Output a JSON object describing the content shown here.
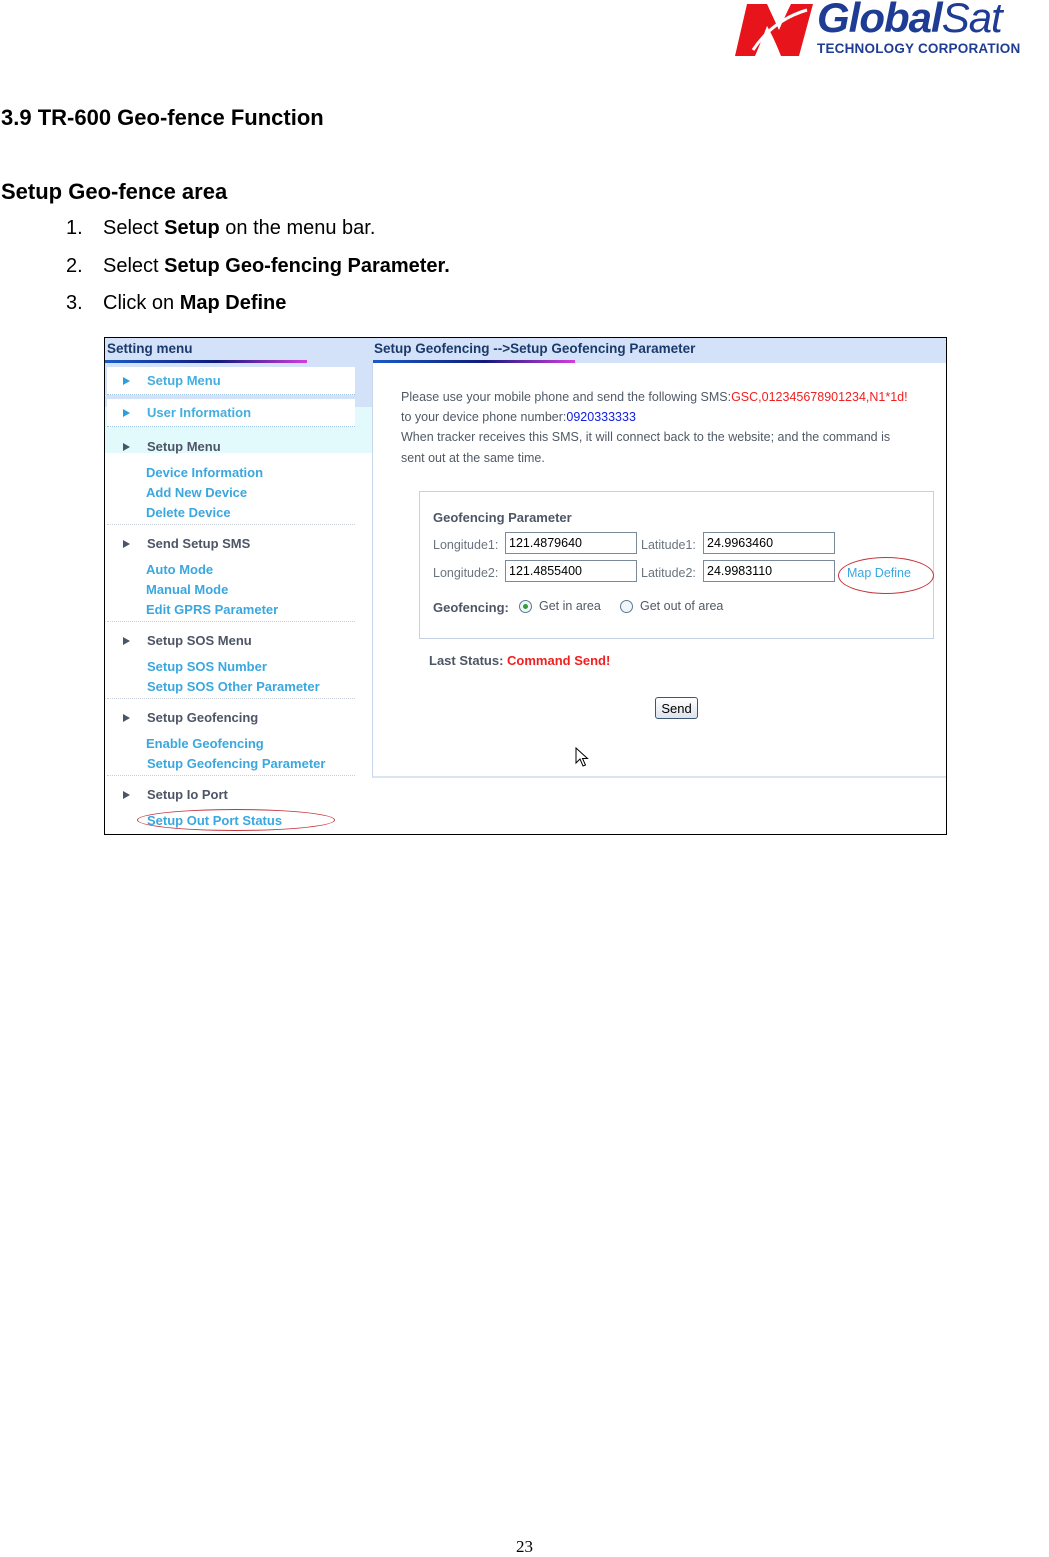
{
  "logo": {
    "icon": "globalsat-n-logo-icon",
    "word_bold": "Global",
    "word_regular": "Sat",
    "subtitle": "TECHNOLOGY CORPORATION",
    "colors": {
      "mark": "#e8141c",
      "text": "#1e3c94"
    }
  },
  "document": {
    "section_title": "3.9 TR-600 Geo-fence Function",
    "subsection_title": "Setup Geo-fence area",
    "steps": [
      {
        "num": "1.",
        "prefix": "Select ",
        "bold": "Setup",
        "suffix": " on the menu bar."
      },
      {
        "num": "2.",
        "prefix": "Select ",
        "bold": "Setup Geo-fencing Parameter.",
        "suffix": ""
      },
      {
        "num": "3.",
        "prefix": "Click on ",
        "bold": "Map Define",
        "suffix": ""
      }
    ],
    "page_number": "23"
  },
  "screenshot": {
    "left_panel": {
      "title": "Setting menu",
      "tabs": [
        {
          "label": "Setup Menu",
          "icon": "triangle-right-icon"
        },
        {
          "label": "User Information",
          "icon": "triangle-right-icon"
        }
      ],
      "groups": [
        {
          "heading": "Setup Menu",
          "links": [
            "Device Information",
            "Add New Device",
            "Delete Device"
          ]
        },
        {
          "heading": "Send Setup SMS",
          "links": [
            "Auto Mode",
            "Manual Mode",
            "Edit GPRS Parameter"
          ]
        },
        {
          "heading": "Setup SOS Menu",
          "links": [
            "Setup SOS Number",
            "Setup SOS Other Parameter"
          ]
        },
        {
          "heading": "Setup Geofencing",
          "links": [
            "Enable Geofencing",
            "Setup Geofencing Parameter"
          ]
        },
        {
          "heading": "Setup Io Port",
          "links": [
            "Setup Out Port Status"
          ]
        }
      ],
      "highlighted_link": "Setup Out Port Status"
    },
    "right_panel": {
      "title": "Setup Geofencing -->Setup Geofencing Parameter",
      "instructions": {
        "line1_prefix": "Please use your mobile phone and send the following SMS:",
        "sms_command": "GSC,012345678901234,N1*1d!",
        "line2_prefix": "to your device phone number:",
        "phone_number": "0920333333",
        "line3": "When tracker receives this SMS, it will connect back to the website; and the command is",
        "line4": "sent out at the same time."
      },
      "param_box": {
        "title": "Geofencing Parameter",
        "longitude1_label": "Longitude1:",
        "longitude1_value": "121.4879640",
        "latitude1_label": "Latitude1:",
        "latitude1_value": "24.9963460",
        "longitude2_label": "Longitude2:",
        "longitude2_value": "121.4855400",
        "latitude2_label": "Latitude2:",
        "latitude2_value": "24.9983110",
        "map_define_link": "Map Define",
        "geofencing_label": "Geofencing:",
        "options": [
          {
            "label": "Get in area",
            "selected": true
          },
          {
            "label": "Get out of area",
            "selected": false
          }
        ]
      },
      "status": {
        "label": "Last Status:",
        "value": "Command Send!"
      },
      "send_button": "Send"
    },
    "colors": {
      "header_bg": "#d3e2f8",
      "link": "#3aa7df",
      "alert_red": "#f02020",
      "annotation_oval": "#c2343b"
    }
  }
}
